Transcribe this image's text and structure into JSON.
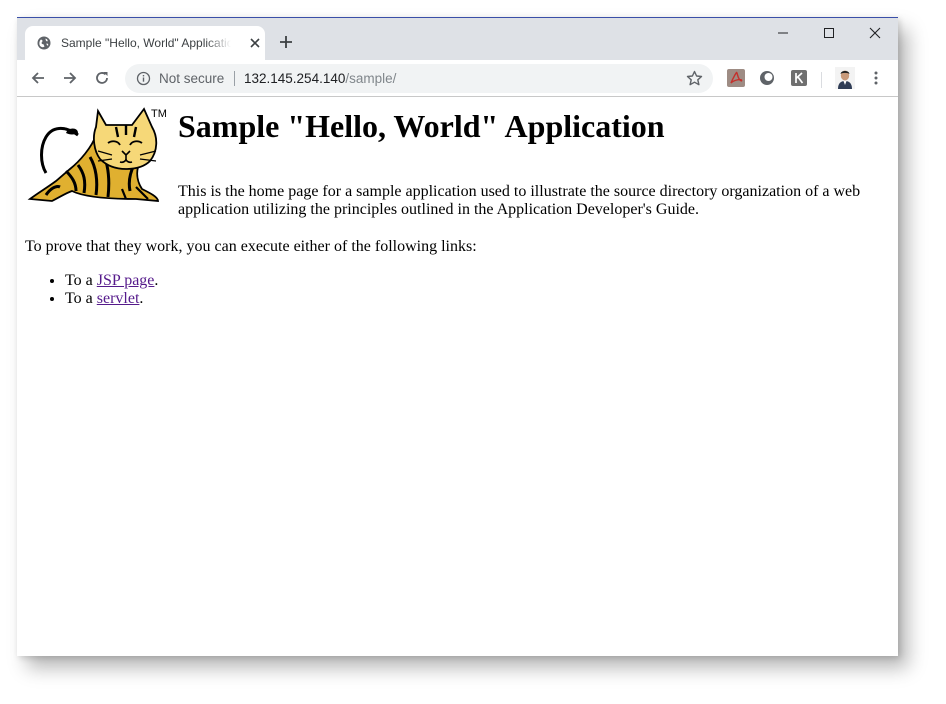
{
  "browser": {
    "tab": {
      "title": "Sample \"Hello, World\" Application",
      "favicon": "globe-icon",
      "close": "close-icon"
    },
    "new_tab": "plus-icon",
    "window_controls": [
      "minimize-icon",
      "maximize-icon",
      "close-icon"
    ],
    "nav": {
      "back": "back-arrow-icon",
      "forward": "forward-arrow-icon",
      "reload": "reload-icon"
    },
    "address": {
      "security_label": "Not secure",
      "url_host": "132.145.254.140",
      "url_path": "/sample/"
    },
    "extensions": [
      "adobe-acrobat-icon",
      "circle-extension-icon",
      "k-extension-icon"
    ],
    "colors": {
      "titlebar": "#dee1e6",
      "link_visited": "#551a8b",
      "logo_yellow": "#e0b030"
    }
  },
  "page": {
    "logo_mark": "TM",
    "heading": "Sample \"Hello, World\" Application",
    "intro": "This is the home page for a sample application used to illustrate the source directory organization of a web application utilizing the principles outlined in the Application Developer's Guide.",
    "prove_text": "To prove that they work, you can execute either of the following links:",
    "links": [
      {
        "prefix": "To a ",
        "link": "JSP page",
        "suffix": "."
      },
      {
        "prefix": "To a ",
        "link": "servlet",
        "suffix": "."
      }
    ]
  }
}
